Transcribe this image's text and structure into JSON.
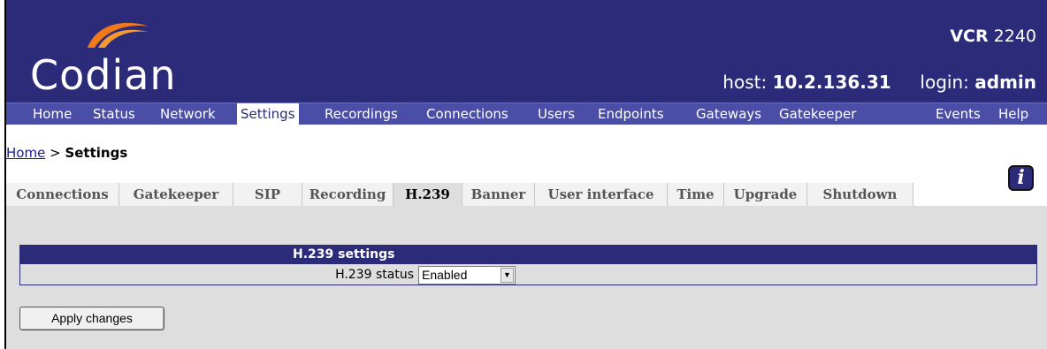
{
  "header": {
    "logo_text": "Codian",
    "product_model": "VCR",
    "product_number": "2240",
    "host_label": "host:",
    "host_value": "10.2.136.31",
    "login_label": "login:",
    "login_value": "admin"
  },
  "nav": {
    "items": [
      {
        "label": "Home"
      },
      {
        "label": "Status"
      },
      {
        "label": "Network"
      },
      {
        "label": "Settings"
      },
      {
        "label": "Recordings"
      },
      {
        "label": "Connections"
      },
      {
        "label": "Users"
      },
      {
        "label": "Endpoints"
      },
      {
        "label": "Gateways"
      },
      {
        "label": "Gatekeeper"
      },
      {
        "label": "Events"
      },
      {
        "label": "Help"
      }
    ],
    "active": "Settings"
  },
  "breadcrumb": {
    "home_link": "Home",
    "separator": ">",
    "current": "Settings"
  },
  "tabs": {
    "items": [
      {
        "label": "Connections"
      },
      {
        "label": "Gatekeeper"
      },
      {
        "label": "SIP"
      },
      {
        "label": "Recording"
      },
      {
        "label": "H.239"
      },
      {
        "label": "Banner"
      },
      {
        "label": "User interface"
      },
      {
        "label": "Time"
      },
      {
        "label": "Upgrade"
      },
      {
        "label": "Shutdown"
      }
    ],
    "active": "H.239"
  },
  "settings": {
    "title": "H.239 settings",
    "status_label": "H.239 status",
    "status_value": "Enabled"
  },
  "actions": {
    "apply_label": "Apply changes"
  },
  "icons": {
    "help": "info-icon",
    "dropdown": "chevron-down-icon"
  },
  "colors": {
    "banner": "#2b2b7a",
    "nav": "#4a4ea6",
    "panel": "#dedede"
  }
}
